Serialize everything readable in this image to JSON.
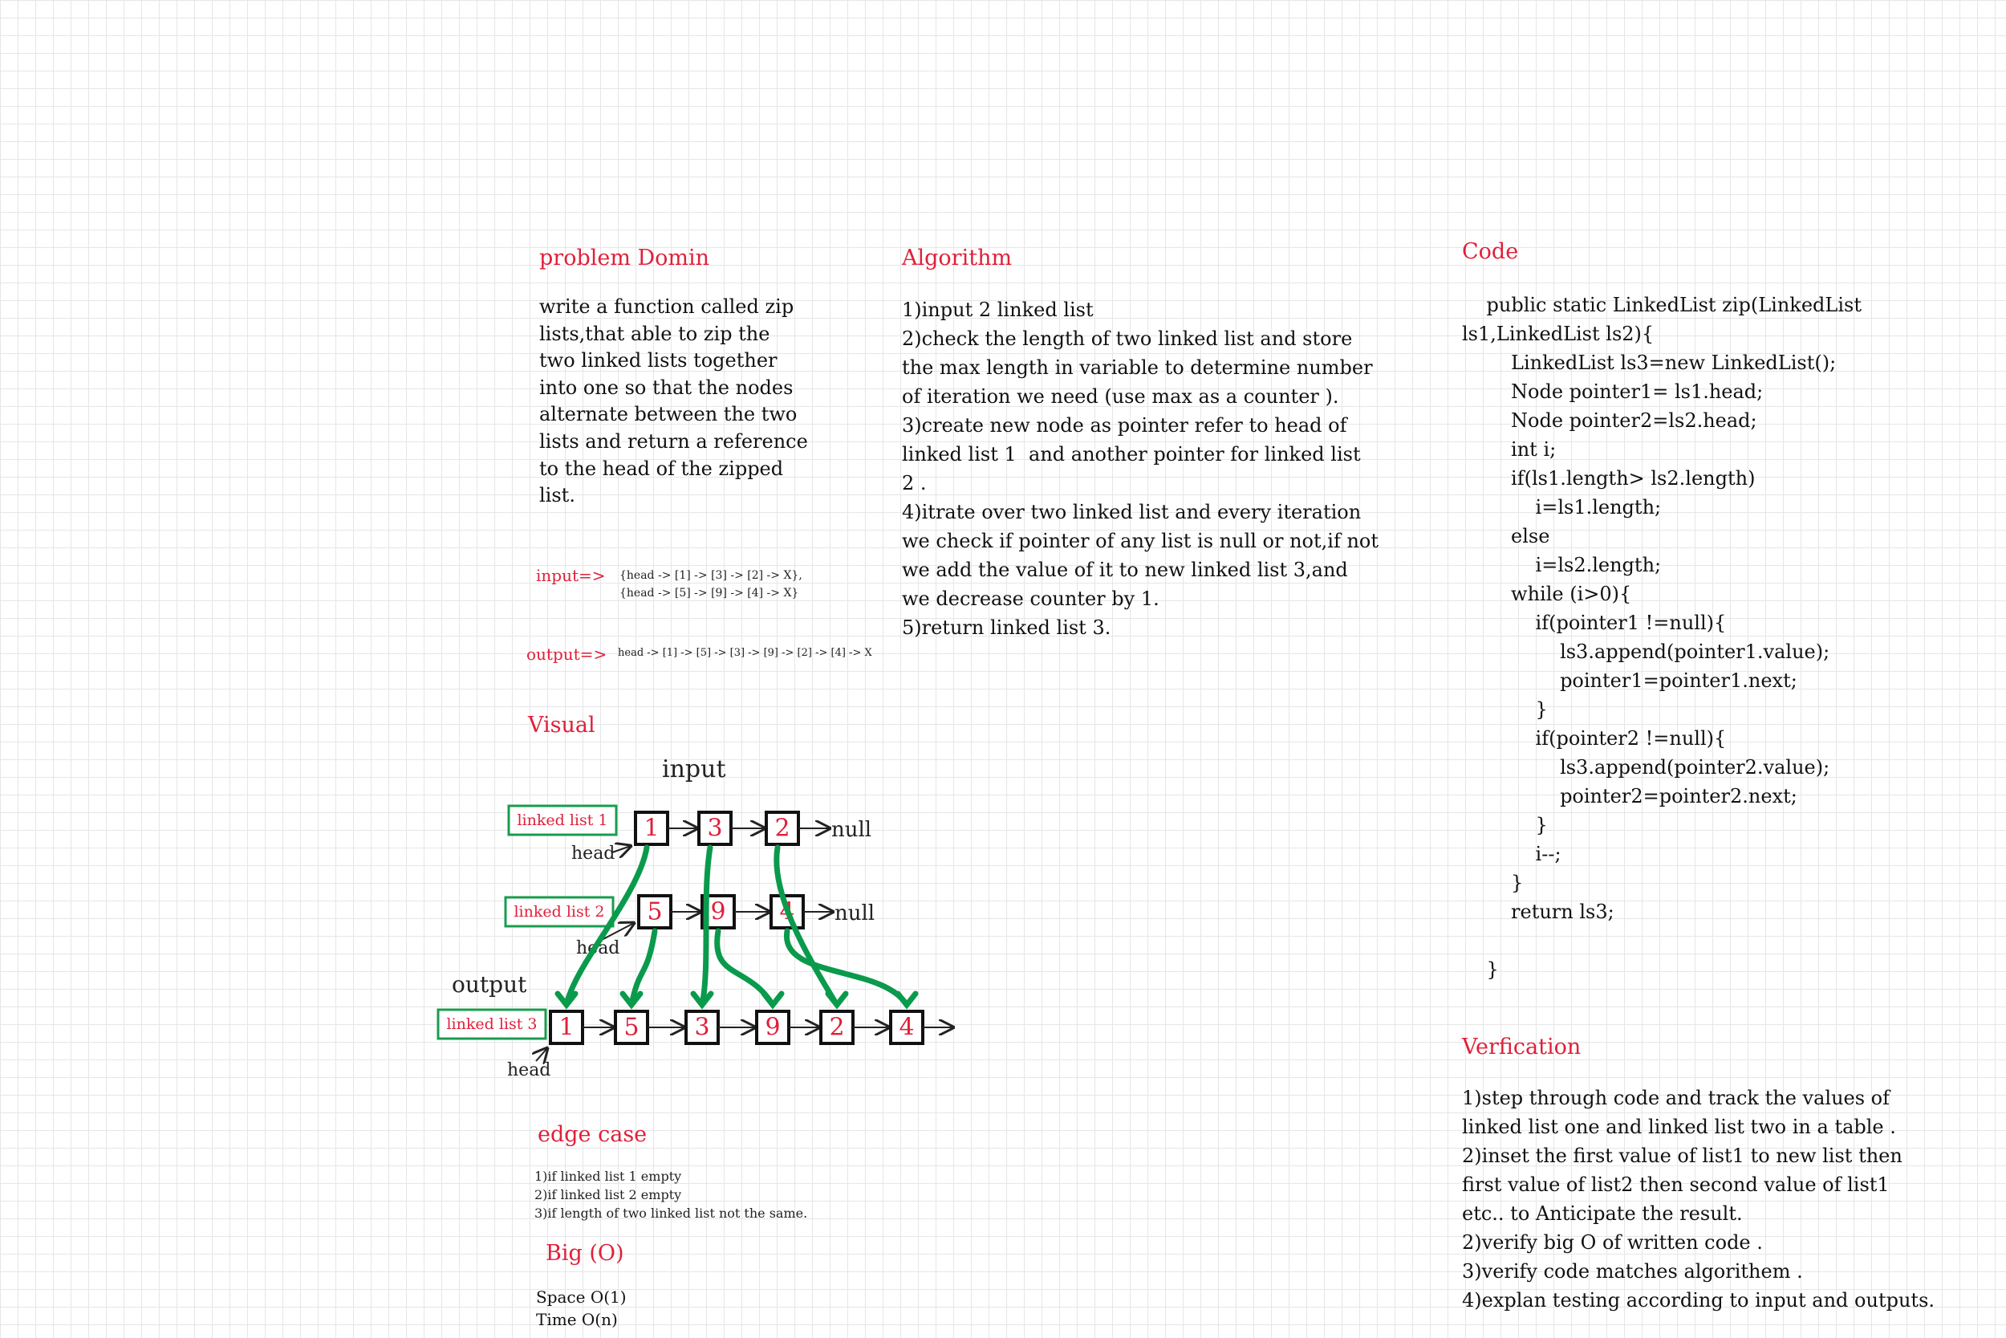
{
  "problem": {
    "heading": "problem Domin",
    "text": "write a function called zip\nlists,that able to zip the\ntwo linked lists together\ninto one so that the nodes\nalternate between the two\nlists and return a reference\nto the head of the zipped\nlist.",
    "input_label": "input=>",
    "input_value": "{head -> [1] -> [3] -> [2] -> X},\n{head -> [5] -> [9] -> [4] -> X}",
    "output_label": "output=>",
    "output_value": "head -> [1] -> [5] -> [3] -> [9] -> [2] -> [4] -> X"
  },
  "algorithm": {
    "heading": "Algorithm",
    "text": "1)input 2 linked list\n2)check the length of two linked list and store\nthe max length in variable to determine number\nof iteration we need (use max as a counter ).\n3)create new node as pointer refer to head of\nlinked list 1  and another pointer for linked list\n2 .\n4)itrate over two linked list and every iteration\nwe check if pointer of any list is null or not,if not\nwe add the value of it to new linked list 3,and\nwe decrease counter by 1.\n5)return linked list 3."
  },
  "code": {
    "heading": "Code",
    "text": "    public static LinkedList zip(LinkedList\nls1,LinkedList ls2){\n        LinkedList ls3=new LinkedList();\n        Node pointer1= ls1.head;\n        Node pointer2=ls2.head;\n        int i;\n        if(ls1.length> ls2.length)\n            i=ls1.length;\n        else\n            i=ls2.length;\n        while (i>0){\n            if(pointer1 !=null){\n                ls3.append(pointer1.value);\n                pointer1=pointer1.next;\n            }\n            if(pointer2 !=null){\n                ls3.append(pointer2.value);\n                pointer2=pointer2.next;\n            }\n            i--;\n        }\n        return ls3;\n\n    }"
  },
  "verification": {
    "heading": "Verfication",
    "text": "1)step through code and track the values of\nlinked list one and linked list two in a table .\n2)inset the first value of list1 to new list then\nfirst value of list2 then second value of list1\netc.. to Anticipate the result.\n2)verify big O of written code .\n3)verify code matches algorithem .\n4)explan testing according to input and outputs."
  },
  "visual": {
    "heading": "Visual",
    "input_title": "input",
    "output_title": "output",
    "head_label": "head",
    "null_label": "null",
    "list1": {
      "label": "linked list 1",
      "values": [
        "1",
        "3",
        "2"
      ]
    },
    "list2": {
      "label": "linked list 2",
      "values": [
        "5",
        "9",
        "4"
      ]
    },
    "list3": {
      "label": "linked list 3",
      "values": [
        "1",
        "5",
        "3",
        "9",
        "2",
        "4"
      ]
    }
  },
  "edge_case": {
    "heading": "edge case",
    "text": "1)if linked list 1 empty\n2)if linked list 2 empty\n3)if length of two linked list not the same."
  },
  "big_o": {
    "heading": "Big (O)",
    "space": "Space O(1)",
    "time": "Time O(n)"
  },
  "colors": {
    "heading": "#e0203a",
    "arrows": "#0a9a4c",
    "box_border": "#1a9c4e"
  }
}
